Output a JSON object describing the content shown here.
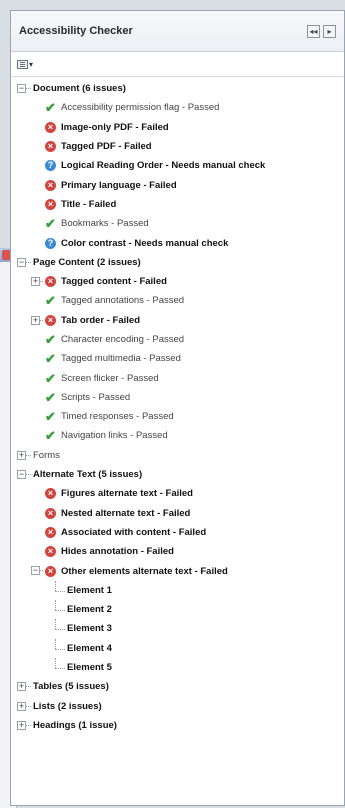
{
  "panel": {
    "title": "Accessibility Checker",
    "header_buttons": [
      "◂◂",
      "▸"
    ],
    "options_caret": "▾"
  },
  "tree": [
    {
      "level": 0,
      "exp": "−",
      "label": "Document (6 issues)",
      "style": "section"
    },
    {
      "level": 1,
      "status": "passed",
      "label": "Accessibility permission flag - Passed"
    },
    {
      "level": 1,
      "status": "failed",
      "label": "Image-only PDF - Failed"
    },
    {
      "level": 1,
      "status": "failed",
      "label": "Tagged PDF - Failed"
    },
    {
      "level": 1,
      "status": "manual",
      "label": "Logical Reading Order - Needs manual check"
    },
    {
      "level": 1,
      "status": "failed",
      "label": "Primary language - Failed"
    },
    {
      "level": 1,
      "status": "failed",
      "label": "Title - Failed"
    },
    {
      "level": 1,
      "status": "passed",
      "label": "Bookmarks - Passed"
    },
    {
      "level": 1,
      "status": "manual",
      "label": "Color contrast - Needs manual check"
    },
    {
      "level": 0,
      "exp": "−",
      "label": "Page Content (2 issues)",
      "style": "section"
    },
    {
      "level": 1,
      "exp": "+",
      "status": "failed",
      "label": "Tagged content - Failed"
    },
    {
      "level": 1,
      "status": "passed",
      "label": "Tagged annotations - Passed"
    },
    {
      "level": 1,
      "exp": "+",
      "status": "failed",
      "label": "Tab order - Failed"
    },
    {
      "level": 1,
      "status": "passed",
      "label": "Character encoding - Passed"
    },
    {
      "level": 1,
      "status": "passed",
      "label": "Tagged multimedia - Passed"
    },
    {
      "level": 1,
      "status": "passed",
      "label": "Screen flicker - Passed"
    },
    {
      "level": 1,
      "status": "passed",
      "label": "Scripts - Passed"
    },
    {
      "level": 1,
      "status": "passed",
      "label": "Timed responses - Passed"
    },
    {
      "level": 1,
      "status": "passed",
      "label": "Navigation links - Passed"
    },
    {
      "level": 0,
      "exp": "+",
      "label": "Forms",
      "style": "plain"
    },
    {
      "level": 0,
      "exp": "−",
      "label": "Alternate Text (5 issues)",
      "style": "section"
    },
    {
      "level": 1,
      "status": "failed",
      "label": "Figures alternate text - Failed"
    },
    {
      "level": 1,
      "status": "failed",
      "label": "Nested alternate text - Failed"
    },
    {
      "level": 1,
      "status": "failed",
      "label": "Associated with content - Failed"
    },
    {
      "level": 1,
      "status": "failed",
      "label": "Hides annotation - Failed"
    },
    {
      "level": 1,
      "exp": "−",
      "status": "failed",
      "label": "Other elements alternate text - Failed"
    },
    {
      "level": 2,
      "label": "Element 1",
      "style": "elem"
    },
    {
      "level": 2,
      "label": "Element 2",
      "style": "elem"
    },
    {
      "level": 2,
      "label": "Element 3",
      "style": "elem"
    },
    {
      "level": 2,
      "label": "Element 4",
      "style": "elem"
    },
    {
      "level": 2,
      "label": "Element 5",
      "style": "elem"
    },
    {
      "level": 0,
      "exp": "+",
      "label": "Tables (5 issues)",
      "style": "section"
    },
    {
      "level": 0,
      "exp": "+",
      "label": "Lists (2 issues)",
      "style": "section"
    },
    {
      "level": 0,
      "exp": "+",
      "label": "Headings (1 issue)",
      "style": "section"
    }
  ]
}
